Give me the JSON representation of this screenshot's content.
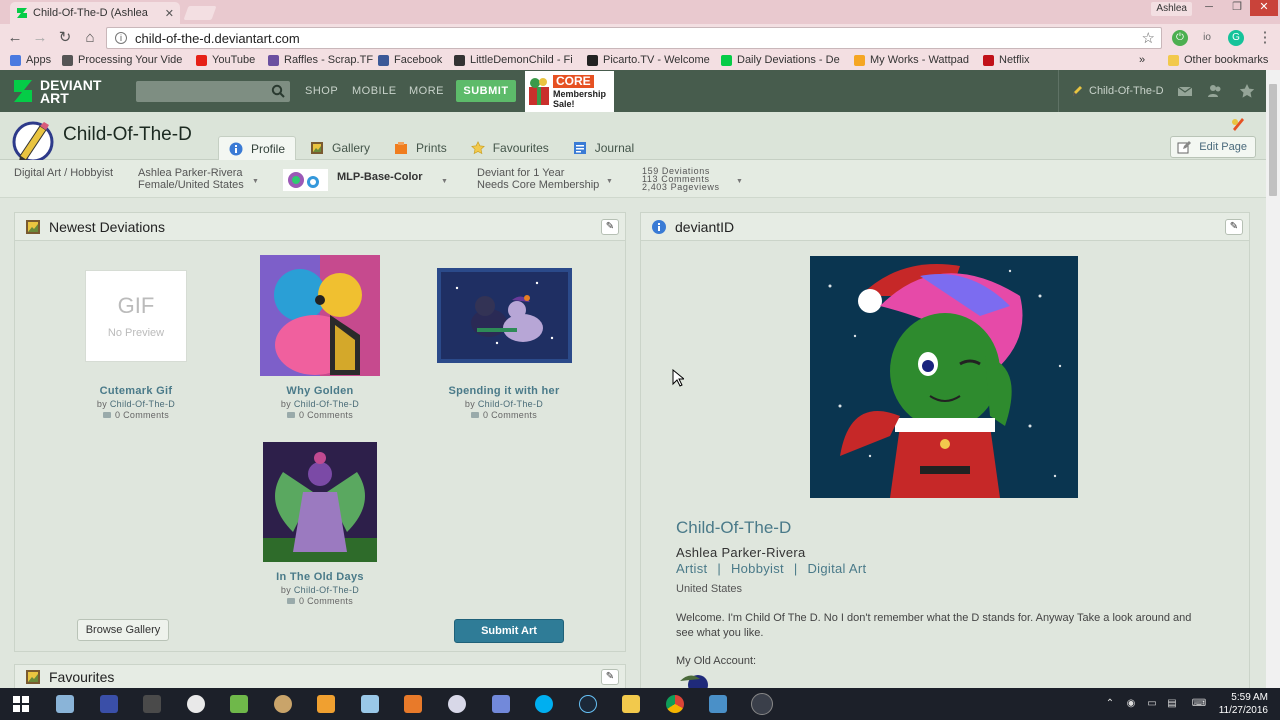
{
  "browser": {
    "tab_title": "Child-Of-The-D (Ashlea",
    "tab_close": "✕",
    "user_badge": "Ashlea",
    "url": "child-of-the-d.deviantart.com",
    "ext_labels": [
      "io",
      "G"
    ],
    "bookmarks": [
      {
        "label": "Apps",
        "color": "#4a7ae0"
      },
      {
        "label": "Processing Your Vide",
        "color": "#555555"
      },
      {
        "label": "YouTube",
        "color": "#e62117"
      },
      {
        "label": "Raffles - Scrap.TF",
        "color": "#6a4fa0"
      },
      {
        "label": "Facebook",
        "color": "#3b5998"
      },
      {
        "label": "LittleDemonChild - Fi",
        "color": "#333333"
      },
      {
        "label": "Picarto.TV - Welcome",
        "color": "#222222"
      },
      {
        "label": "Daily Deviations - De",
        "color": "#05cc47"
      },
      {
        "label": "My Works - Wattpad",
        "color": "#f5a623"
      },
      {
        "label": "Netflix",
        "color": "#c11119"
      }
    ],
    "bookmarks_overflow": "»",
    "other_bookmarks": "Other bookmarks"
  },
  "da": {
    "logo_line1": "DEVIANT",
    "logo_line2": "ART",
    "nav": [
      "SHOP",
      "MOBILE",
      "MORE"
    ],
    "submit": "SUBMIT",
    "ad_core": "CORE",
    "ad_line1": "Membership",
    "ad_line2": "Sale!",
    "username": "Child-Of-The-D"
  },
  "profile": {
    "name": "Child-Of-The-D",
    "tabs": [
      {
        "label": "Profile",
        "icon": "info-icon"
      },
      {
        "label": "Gallery",
        "icon": "gallery-icon"
      },
      {
        "label": "Prints",
        "icon": "prints-icon"
      },
      {
        "label": "Favourites",
        "icon": "star-icon"
      },
      {
        "label": "Journal",
        "icon": "journal-icon"
      }
    ],
    "edit_page": "Edit Page",
    "category": "Digital Art / Hobbyist",
    "real_name": "Ashlea Parker-Rivera",
    "gender_loc": "Female/United States",
    "mlp": "MLP-Base-Color",
    "deviant_for": "Deviant for 1 Year",
    "needs_core": "Needs Core Membership",
    "stats": {
      "deviations": "159 Deviations",
      "comments": "113 Comments",
      "pageviews": "2,403 Pageviews"
    }
  },
  "newest": {
    "title": "Newest Deviations",
    "gif_label": "GIF",
    "gif_sub": "No Preview",
    "by": "by",
    "items": [
      {
        "title": "Cutemark Gif",
        "author": "Child-Of-The-D",
        "comments": "0 Comments"
      },
      {
        "title": "Why Golden",
        "author": "Child-Of-The-D",
        "comments": "0 Comments"
      },
      {
        "title": "Spending it with her",
        "author": "Child-Of-The-D",
        "comments": "0 Comments"
      },
      {
        "title": "In The Old Days",
        "author": "Child-Of-The-D",
        "comments": "0 Comments"
      }
    ],
    "browse": "Browse Gallery",
    "submit": "Submit Art"
  },
  "favourites": {
    "title": "Favourites"
  },
  "deviantid": {
    "title": "deviantID",
    "name": "Child-Of-The-D",
    "real_name": "Ashlea Parker-Rivera",
    "tag1": "Artist",
    "tag2": "Hobbyist",
    "tag3": "Digital Art",
    "sep": "|",
    "country": "United States",
    "bio": "Welcome. I'm Child Of The D. No I don't remember what the D stands for. Anyway Take a look around and see what you like.",
    "old_account": "My Old Account:"
  },
  "taskbar": {
    "time": "5:59 AM",
    "date": "11/27/2016"
  },
  "colors": {
    "da_green": "#475c4d",
    "submit_green": "#5dbb6a",
    "link_teal": "#4a7a89",
    "button_blue": "#2f7c97"
  }
}
